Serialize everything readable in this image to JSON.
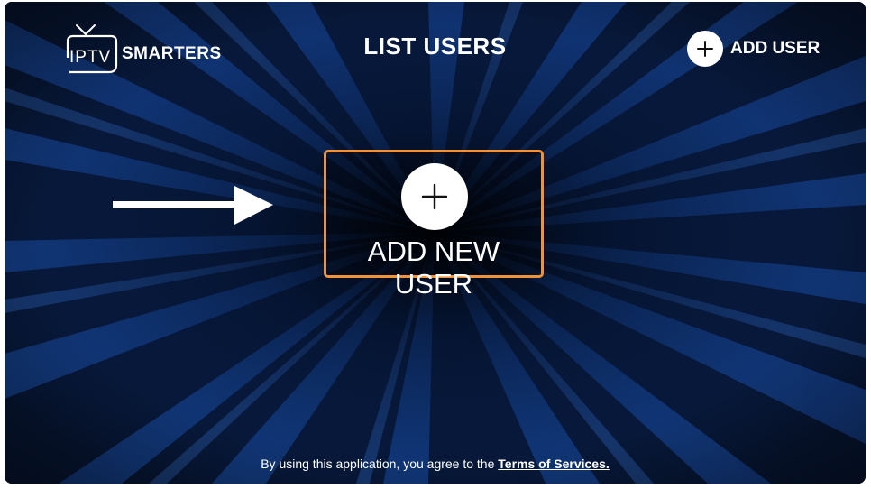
{
  "logo": {
    "brand_left": "IPTV",
    "brand_right": "SMARTERS"
  },
  "header": {
    "title": "LIST USERS",
    "add_user_label": "ADD USER",
    "add_user_icon": "plus-icon"
  },
  "main": {
    "add_new_user_label": "ADD NEW USER",
    "add_new_user_icon": "plus-icon",
    "pointer": "arrow-right-icon"
  },
  "footer": {
    "prefix": "By using this application, you agree to the",
    "terms_link": "Terms of Services."
  },
  "colors": {
    "background": "#050b18",
    "ray_blue": "#1b4fa8",
    "highlight_border": "#f0923a",
    "text": "#ffffff"
  }
}
